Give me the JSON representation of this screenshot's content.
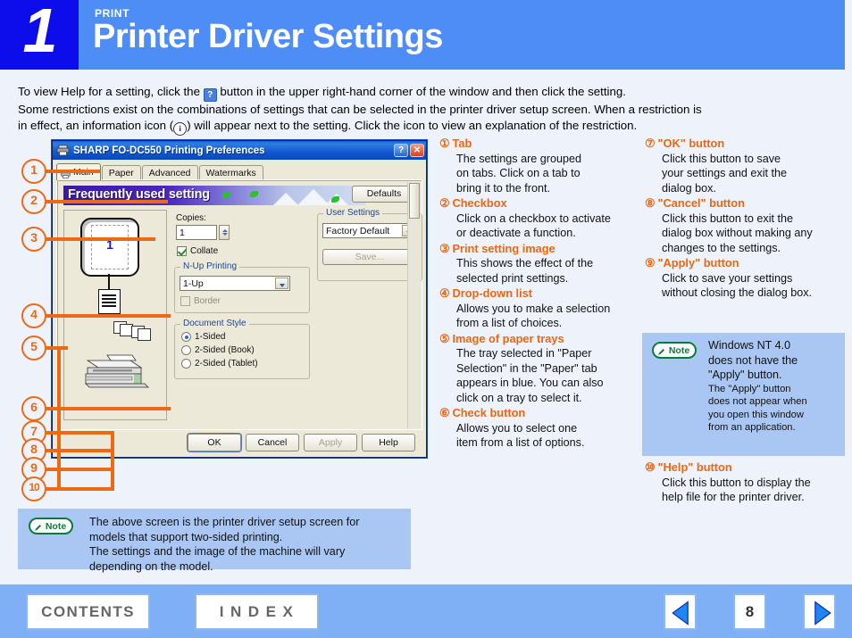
{
  "header": {
    "number": "1",
    "kicker": "PRINT",
    "title": "Printer Driver Settings",
    "number_bg": "#0d0deb",
    "bar_bg": "#4f8df6"
  },
  "intro": {
    "line1a": "To view Help for a setting, click the",
    "help_icon": "?",
    "line1b": "button in the upper right-hand corner of the window and then click the setting.",
    "line2": "Some restrictions exist on the combinations of settings that can be selected in the printer driver setup screen. When a restriction is",
    "line3a": "in effect, an information icon (",
    "info_icon": "i",
    "line3b": ") will appear next to the setting. Click the icon to view an explanation of the restriction."
  },
  "callout_numbers": [
    "1",
    "2",
    "3",
    "4",
    "5",
    "6",
    "7",
    "8",
    "9",
    "10"
  ],
  "dialog": {
    "title": "SHARP FO-DC550 Printing Preferences",
    "help_button": "?",
    "close_button": "✕",
    "tabs": [
      {
        "label": "Main",
        "active": true
      },
      {
        "label": "Paper",
        "active": false
      },
      {
        "label": "Advanced",
        "active": false
      },
      {
        "label": "Watermarks",
        "active": false
      }
    ],
    "banner_label": "Frequently used setting",
    "defaults_button": "Defaults",
    "copies_label": "Copies:",
    "copies_value": "1",
    "collate_label": "Collate",
    "collate_checked": true,
    "nup_group_label": "N-Up Printing",
    "nup_value": "1-Up",
    "border_label": "Border",
    "border_checked": false,
    "docstyle_group_label": "Document Style",
    "docstyle_options": [
      "1-Sided",
      "2-Sided (Book)",
      "2-Sided (Tablet)"
    ],
    "docstyle_selected": 0,
    "usersettings_group_label": "User Settings",
    "usersettings_value": "Factory Default",
    "save_button": "Save...",
    "preview_page_number": "1",
    "buttons": [
      {
        "label": "OK",
        "enabled": true,
        "default": true
      },
      {
        "label": "Cancel",
        "enabled": true,
        "default": false
      },
      {
        "label": "Apply",
        "enabled": false,
        "default": false
      },
      {
        "label": "Help",
        "enabled": true,
        "default": false
      }
    ]
  },
  "col_mid": [
    {
      "n": "①",
      "title": "Tab",
      "body": [
        "The settings are grouped",
        "on tabs. Click on a tab to",
        "bring it to the front."
      ]
    },
    {
      "n": "②",
      "title": "Checkbox",
      "body": [
        "Click on a checkbox to activate",
        "or deactivate a function."
      ]
    },
    {
      "n": "③",
      "title": "Print setting image",
      "body": [
        "This shows the effect of the",
        "selected print settings."
      ]
    },
    {
      "n": "④",
      "title": "Drop-down list",
      "body": [
        "Allows you to make a selection",
        "from a list of choices."
      ]
    },
    {
      "n": "⑤",
      "title": "Image of paper trays",
      "body": [
        "The tray selected in \"Paper",
        "Selection\" in the \"Paper\" tab",
        "appears in blue. You can also",
        "click on a tray to select it."
      ]
    },
    {
      "n": "⑥",
      "title": "Check button",
      "body": [
        "Allows you to select one",
        "item from a list of options."
      ]
    }
  ],
  "col_right": [
    {
      "n": "⑦",
      "title": "\"OK\" button",
      "body": [
        "Click this button to save",
        "your settings and exit the",
        "dialog box."
      ]
    },
    {
      "n": "⑧",
      "title": "\"Cancel\" button",
      "body": [
        "Click this button to exit the",
        "dialog box without making any",
        "changes to the settings."
      ]
    },
    {
      "n": "⑨",
      "title": "\"Apply\" button",
      "body": [
        "Click to save your settings",
        "without closing the dialog box."
      ]
    }
  ],
  "col_right_tail": [
    {
      "n": "⑩",
      "title": "\"Help\" button",
      "body": [
        "Click this button to display the",
        "help file for the printer driver."
      ]
    }
  ],
  "note_right": {
    "label": "Note",
    "lines_big": [
      "Windows NT 4.0",
      "does not have the",
      "\"Apply\" button."
    ],
    "lines_small": [
      "The \"Apply\" button",
      "does not appear when",
      "you open this window",
      "from an application."
    ]
  },
  "note_bottom": {
    "label": "Note",
    "lines": [
      "The above screen is the printer driver setup screen for",
      "models that support two-sided printing.",
      "The settings and the image of the machine will vary",
      "depending on the model."
    ]
  },
  "footer": {
    "contents_label": "CONTENTS",
    "index_label": "I N D E X",
    "page_number": "8",
    "prev_icon": "prev-arrow-icon",
    "next_icon": "next-arrow-icon",
    "bg": "#7fb0f5"
  }
}
